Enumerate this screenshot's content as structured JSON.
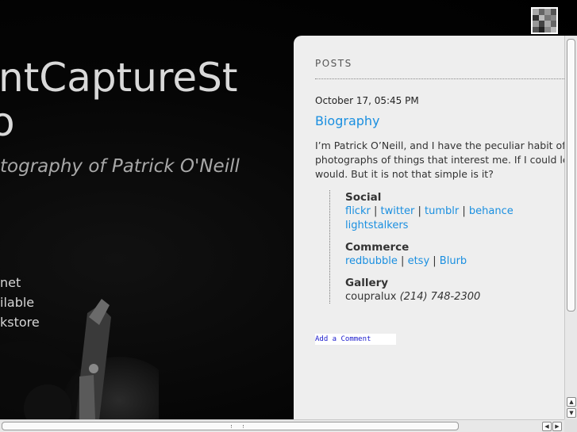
{
  "header": {
    "title_line1": "ntCaptureSt",
    "title_line2": "o",
    "tagline": "tography of Patrick O'Neill"
  },
  "left_links": [
    "net",
    "ilable",
    "kstore"
  ],
  "posts": {
    "heading": "POSTS",
    "post": {
      "date": "October 17, 05:45 PM",
      "title": "Biography",
      "body_lines": [
        "I’m Patrick O’Neill, and I have the peculiar habit of ta",
        "photographs of things that interest me. If I could le",
        "would. But it is not that simple is it?"
      ],
      "social": {
        "heading": "Social",
        "links": [
          "flickr",
          "twitter",
          "tumblr",
          "behance",
          "lightstalkers"
        ]
      },
      "commerce": {
        "heading": "Commerce",
        "links": [
          "redbubble",
          "etsy",
          "Blurb"
        ]
      },
      "gallery": {
        "heading": "Gallery",
        "name": "coupralux",
        "phone": "(214) 748-2300"
      }
    },
    "add_comment": "Add a Comment"
  },
  "colors": {
    "link": "#1a8fe0",
    "panel_bg": "#eeeeee",
    "page_bg": "#000000"
  }
}
